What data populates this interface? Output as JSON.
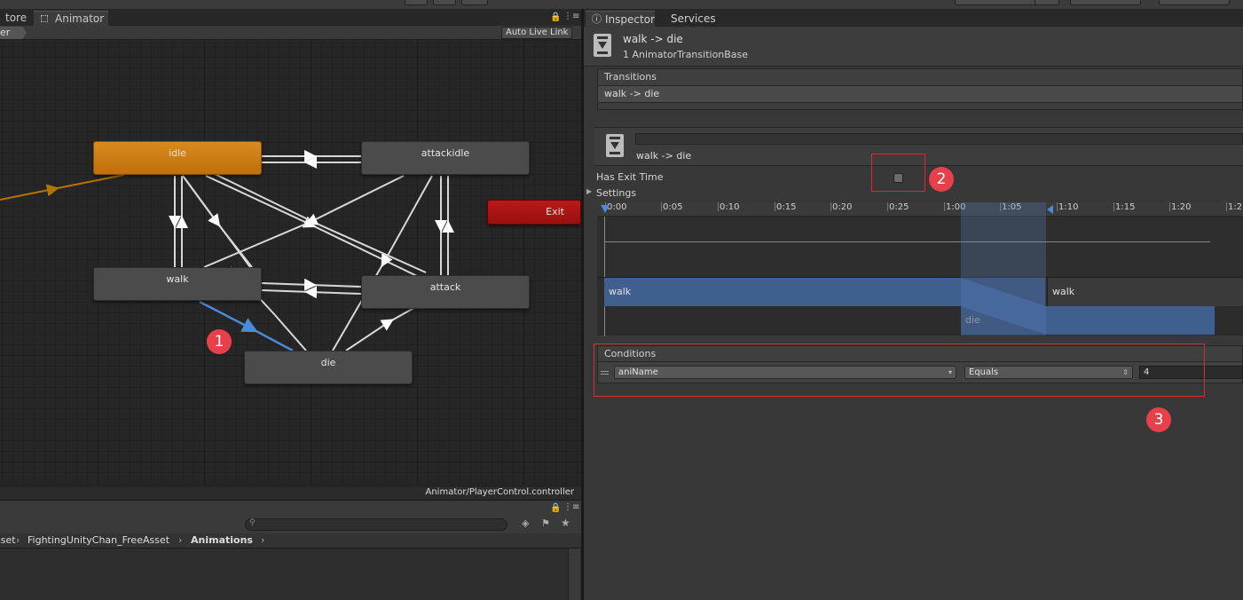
{
  "window": {
    "left_tabs": [
      {
        "label": "tore"
      },
      {
        "label": "Animator"
      }
    ],
    "inspector_tabs": [
      {
        "label": "Inspector"
      },
      {
        "label": "Services"
      }
    ]
  },
  "animator": {
    "breadcrumb_layer": "er",
    "auto_live_link": "Auto Live Link",
    "controller_path": "Animator/PlayerControl.controller",
    "states": {
      "idle": "idle",
      "attackidle": "attackidle",
      "walk": "walk",
      "attack": "attack",
      "die": "die",
      "exit": "Exit"
    },
    "colors": {
      "default_state": "#d2801a",
      "exit_state": "#ab1414",
      "selected_transition": "#4a8ad8",
      "entry_transition": "#b57400"
    }
  },
  "project": {
    "breadcrumb": [
      "sset",
      "FightingUnityChan_FreeAsset",
      "Animations"
    ]
  },
  "inspector": {
    "title": "walk -> die",
    "subtitle": "1 AnimatorTransitionBase",
    "transitions_header": "Transitions",
    "transitions_items": [
      "walk -> die"
    ],
    "transition_name": "walk -> die",
    "has_exit_time_label": "Has Exit Time",
    "has_exit_time": false,
    "settings_label": "Settings",
    "timeline_ticks": [
      "0:00",
      "0:05",
      "0:10",
      "0:15",
      "0:20",
      "0:25",
      "1:00",
      "1:05",
      "1:10",
      "1:15",
      "1:20",
      "1:2"
    ],
    "clip_source": "walk",
    "clip_dest": "die",
    "clip_source_tail": "walk",
    "conditions_header": "Conditions",
    "condition": {
      "parameter": "aniName",
      "mode": "Equals",
      "value": "4"
    }
  },
  "annotations": {
    "marker_1": "1",
    "marker_2": "2",
    "marker_3": "3"
  }
}
